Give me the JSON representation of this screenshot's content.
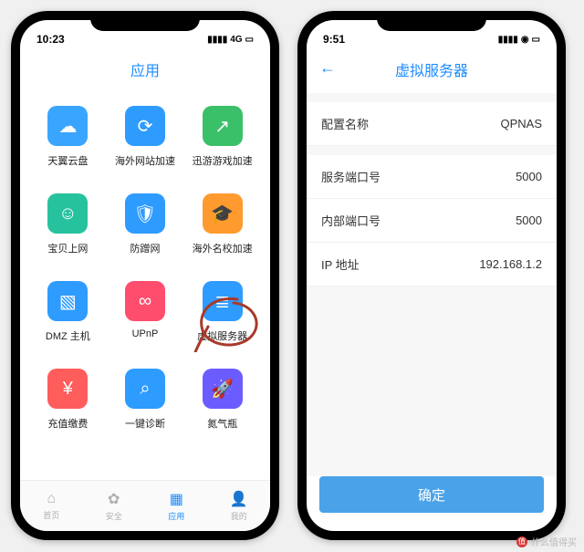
{
  "left": {
    "status": {
      "time": "10:23",
      "net": "4G"
    },
    "title": "应用",
    "apps": [
      {
        "label": "天翼云盘",
        "name": "app-cloud",
        "color": "#3aa5ff",
        "glyph": "☁"
      },
      {
        "label": "海外网站加速",
        "name": "app-web-accel",
        "color": "#2e9bff",
        "glyph": "⟳"
      },
      {
        "label": "迅游游戏加速",
        "name": "app-game-accel",
        "color": "#3bc06a",
        "glyph": "↗"
      },
      {
        "label": "宝贝上网",
        "name": "app-kids",
        "color": "#26c29e",
        "glyph": "☺"
      },
      {
        "label": "防蹭网",
        "name": "app-anti-leech",
        "color": "#2e9bff",
        "glyph": "🛡"
      },
      {
        "label": "海外名校加速",
        "name": "app-school-accel",
        "color": "#ff9a2e",
        "glyph": "🎓"
      },
      {
        "label": "DMZ 主机",
        "name": "app-dmz",
        "color": "#2e9bff",
        "glyph": "▧"
      },
      {
        "label": "UPnP",
        "name": "app-upnp",
        "color": "#ff4d6e",
        "glyph": "∞"
      },
      {
        "label": "虚拟服务器",
        "name": "app-virtual-server",
        "color": "#2e9bff",
        "glyph": "≣"
      },
      {
        "label": "充值缴费",
        "name": "app-recharge",
        "color": "#ff5c5c",
        "glyph": "¥"
      },
      {
        "label": "一键诊断",
        "name": "app-diagnose",
        "color": "#2e9bff",
        "glyph": "⌕"
      },
      {
        "label": "氮气瓶",
        "name": "app-nitro",
        "color": "#6b5cff",
        "glyph": "🚀"
      }
    ],
    "tabs": [
      {
        "label": "首页",
        "name": "tab-home",
        "glyph": "⌂",
        "active": false
      },
      {
        "label": "安全",
        "name": "tab-security",
        "glyph": "✿",
        "active": false
      },
      {
        "label": "应用",
        "name": "tab-apps",
        "glyph": "▦",
        "active": true
      },
      {
        "label": "我的",
        "name": "tab-me",
        "glyph": "👤",
        "active": false
      }
    ]
  },
  "right": {
    "status": {
      "time": "9:51"
    },
    "title": "虚拟服务器",
    "fields": {
      "name_label": "配置名称",
      "name_value": "QPNAS",
      "svcport_label": "服务端口号",
      "svcport_value": "5000",
      "intport_label": "内部端口号",
      "intport_value": "5000",
      "ip_label": "IP 地址",
      "ip_value": "192.168.1.2"
    },
    "confirm": "确定"
  },
  "watermark": "什么值得买"
}
